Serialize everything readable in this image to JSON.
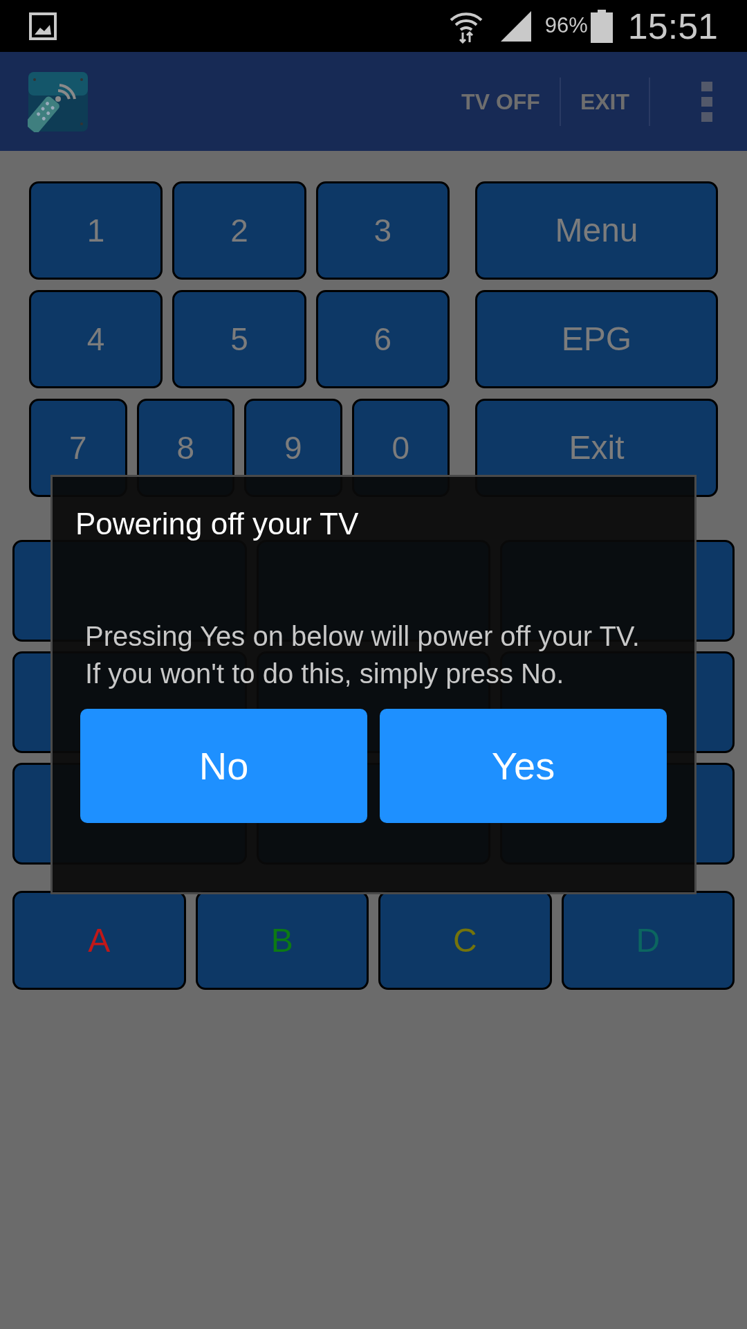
{
  "status_bar": {
    "battery": "96%",
    "time": "15:51"
  },
  "app_bar": {
    "actions": [
      "TV OFF",
      "EXIT"
    ]
  },
  "keypad": {
    "number_rows": [
      [
        "1",
        "2",
        "3"
      ],
      [
        "4",
        "5",
        "6"
      ],
      [
        "7",
        "8",
        "9",
        "0"
      ]
    ],
    "side_keys": [
      "Menu",
      "EPG",
      "Exit"
    ]
  },
  "color_keys": [
    {
      "label": "A",
      "color": "#c01818"
    },
    {
      "label": "B",
      "color": "#0c7a14"
    },
    {
      "label": "C",
      "color": "#74740c"
    },
    {
      "label": "D",
      "color": "#0c6660"
    }
  ],
  "dialog": {
    "title": "Powering off your TV",
    "message": "Pressing Yes on below will power off your TV. If you won't to do this, simply press No.",
    "buttons": [
      "No",
      "Yes"
    ]
  }
}
